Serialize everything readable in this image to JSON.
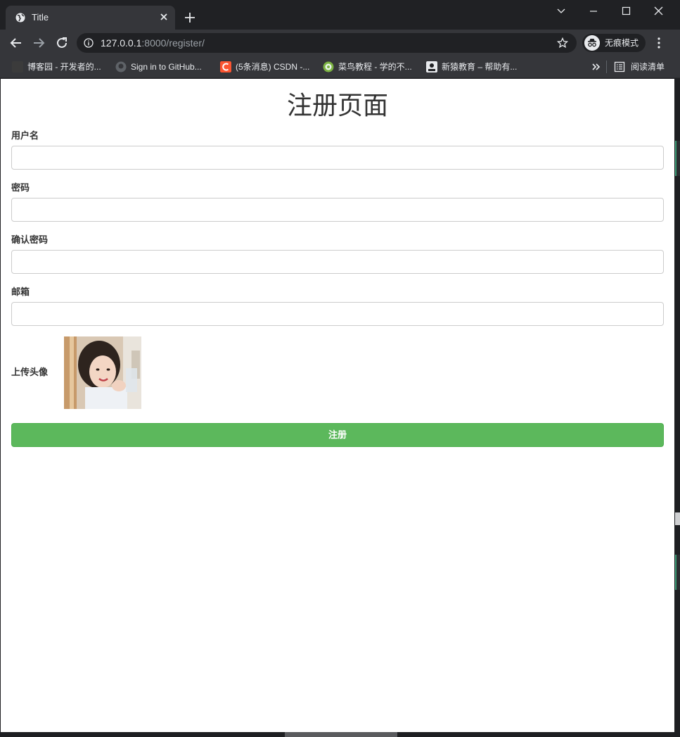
{
  "browser": {
    "tab_title": "Title",
    "url_host": "127.0.0.1",
    "url_rest": ":8000/register/",
    "incognito_label": "无痕模式",
    "bookmarks": [
      {
        "label": "博客园 - 开发者的...",
        "icon_color": "#3b3b3b"
      },
      {
        "label": "Sign in to GitHub...",
        "icon_color": "#24292e"
      },
      {
        "label": "(5条消息) CSDN -...",
        "icon_color": "#fc5531"
      },
      {
        "label": "菜鸟教程 - 学的不...",
        "icon_color": "#7cb342"
      },
      {
        "label": "新猿教育 – 帮助有...",
        "icon_color": "#e8eaed"
      }
    ],
    "reading_list_label": "阅读清单"
  },
  "page": {
    "title": "注册页面",
    "fields": [
      {
        "label": "用户名",
        "value": "",
        "type": "text"
      },
      {
        "label": "密码",
        "value": "",
        "type": "password"
      },
      {
        "label": "确认密码",
        "value": "",
        "type": "password"
      },
      {
        "label": "邮箱",
        "value": "",
        "type": "email"
      }
    ],
    "avatar_label": "上传头像",
    "submit_label": "注册"
  },
  "colors": {
    "submit_bg": "#5cb85c",
    "chrome_dark": "#202124",
    "chrome_toolbar": "#35363a"
  }
}
